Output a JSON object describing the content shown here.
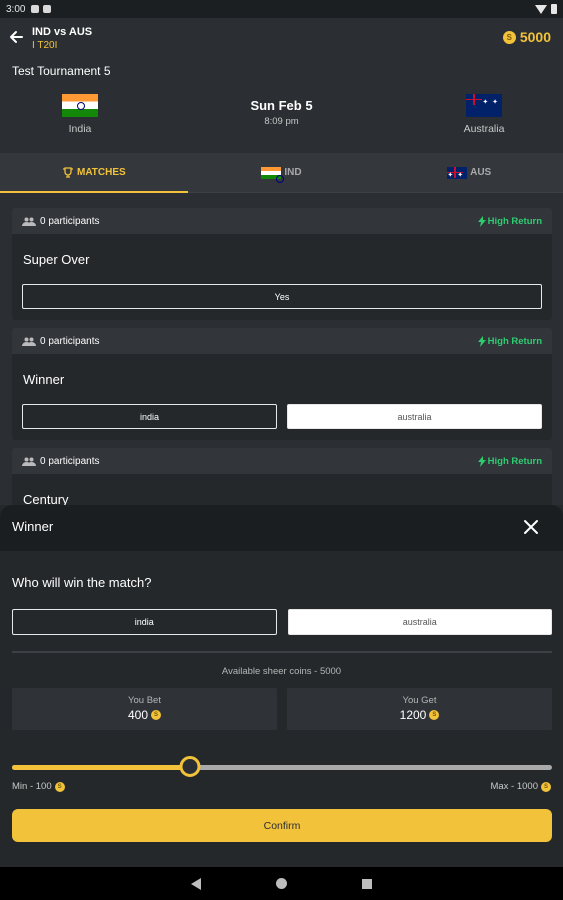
{
  "status_bar": {
    "time": "3:00"
  },
  "header": {
    "match_title": "IND vs AUS",
    "match_format": "I T20I",
    "coins": "5000",
    "tournament": "Test Tournament 5",
    "team_left": "India",
    "team_right": "Australia",
    "date": "Sun Feb 5",
    "time": "8:09 pm"
  },
  "tabs": [
    {
      "label": "MATCHES",
      "icon": "trophy-icon",
      "active": true
    },
    {
      "label": "IND",
      "icon": "india-flag-icon",
      "active": false
    },
    {
      "label": "AUS",
      "icon": "australia-flag-icon",
      "active": false
    }
  ],
  "cards": [
    {
      "participants": "0 participants",
      "badge": "High Return",
      "question": "Super Over",
      "options": [
        "Yes"
      ]
    },
    {
      "participants": "0 participants",
      "badge": "High Return",
      "question": "Winner",
      "options": [
        "india",
        "australia"
      ]
    },
    {
      "participants": "0 participants",
      "badge": "High Return",
      "question": "Century",
      "options": []
    }
  ],
  "sheet": {
    "title": "Winner",
    "question": "Who will win the match?",
    "options": [
      "india",
      "australia"
    ],
    "selected_option": "india",
    "available": "Available sheer coins - 5000",
    "you_bet_label": "You Bet",
    "you_bet_value": "400",
    "you_get_label": "You Get",
    "you_get_value": "1200",
    "slider_fraction": 0.33,
    "min_label": "Min - 100",
    "max_label": "Max - 1000",
    "confirm_label": "Confirm"
  },
  "colors": {
    "accent": "#f2c23a",
    "high_return": "#2ecc71",
    "background": "#2b2f33"
  }
}
